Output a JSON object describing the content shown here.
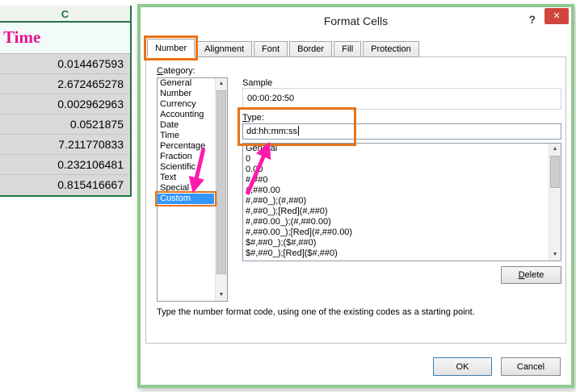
{
  "sheet": {
    "column_letter": "C",
    "header": "Time",
    "values": [
      "0.014467593",
      "2.672465278",
      "0.002962963",
      "0.0521875",
      "7.211770833",
      "0.232106481",
      "0.815416667"
    ]
  },
  "dialog": {
    "title": "Format Cells",
    "tabs": [
      "Number",
      "Alignment",
      "Font",
      "Border",
      "Fill",
      "Protection"
    ],
    "selected_tab": "Number",
    "category_label": "Category:",
    "categories": [
      "General",
      "Number",
      "Currency",
      "Accounting",
      "Date",
      "Time",
      "Percentage",
      "Fraction",
      "Scientific",
      "Text",
      "Special",
      "Custom"
    ],
    "selected_category": "Custom",
    "sample_label": "Sample",
    "sample_value": "00:00:20:50",
    "type_label": "Type:",
    "type_value": "dd:hh:mm:ss",
    "format_codes": [
      "General",
      "0",
      "0.00",
      "#,##0",
      "#,##0.00",
      "#,##0_);(#,##0)",
      "#,##0_);[Red](#,##0)",
      "#,##0.00_);(#,##0.00)",
      "#,##0.00_);[Red](#,##0.00)",
      "$#,##0_);($#,##0)",
      "$#,##0_);[Red]($#,##0)"
    ],
    "delete_label": "Delete",
    "help_text": "Type the number format code, using one of the existing codes as a starting point.",
    "ok_label": "OK",
    "cancel_label": "Cancel"
  },
  "icons": {
    "help": "?",
    "close": "✕",
    "scroll_up": "▲",
    "scroll_down": "▼"
  },
  "colors": {
    "dialog_border": "#8fca8f",
    "selection_blue": "#3297fd",
    "annotation_orange": "#e8731a",
    "arrow_pink": "#ff1aad",
    "excel_green": "#217346",
    "time_header_pink": "#e6128e",
    "close_red": "#d0453c",
    "cell_gray": "#d9d9d9"
  }
}
